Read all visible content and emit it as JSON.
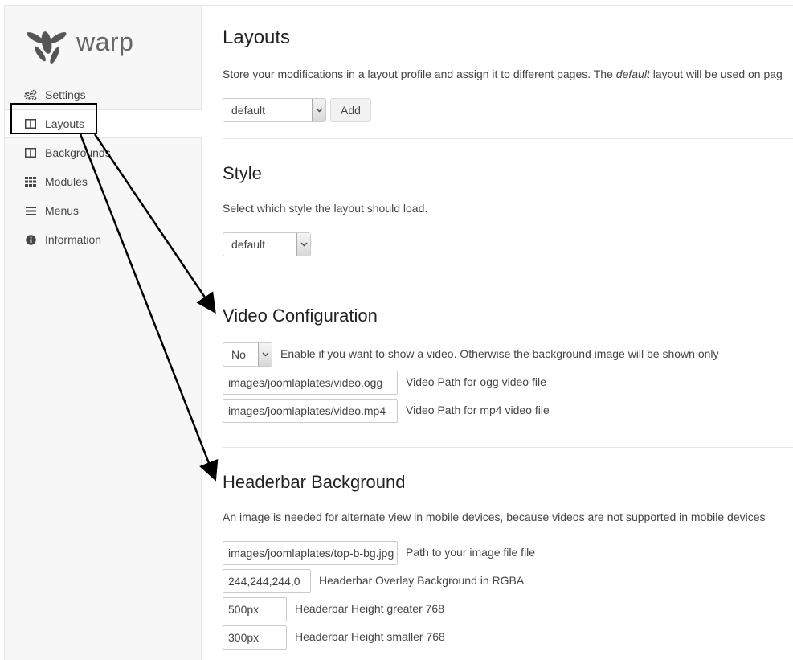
{
  "app": {
    "logo_text": "warp"
  },
  "sidebar": {
    "items": [
      {
        "label": "Settings",
        "icon": "gears-icon"
      },
      {
        "label": "Layouts",
        "icon": "columns-icon",
        "active": true
      },
      {
        "label": "Backgrounds",
        "icon": "columns-icon"
      },
      {
        "label": "Modules",
        "icon": "grid-icon"
      },
      {
        "label": "Menus",
        "icon": "bars-icon"
      },
      {
        "label": "Information",
        "icon": "info-circle-icon"
      }
    ]
  },
  "layouts": {
    "title": "Layouts",
    "desc_before": "Store your modifications in a layout profile and assign it to different pages. The ",
    "desc_em": "default",
    "desc_after": " layout will be used on pag",
    "select_value": "default",
    "add_label": "Add"
  },
  "style": {
    "title": "Style",
    "desc": "Select which style the layout should load.",
    "select_value": "default"
  },
  "video": {
    "title": "Video Configuration",
    "enable_value": "No",
    "enable_desc": "Enable if you want to show a video. Otherwise the background image will be shown only",
    "ogg_value": "images/joomlaplates/video.ogg",
    "ogg_label": "Video Path for ogg video file",
    "mp4_value": "images/joomlaplates/video.mp4",
    "mp4_label": "Video Path for mp4 video file"
  },
  "headerbar": {
    "title": "Headerbar Background",
    "desc": "An image is needed for alternate view in mobile devices, because videos are not supported in mobile devices",
    "image_value": "images/joomlaplates/top-b-bg.jpg",
    "image_label": "Path to your image file file",
    "rgba_value": "244,244,244,0",
    "rgba_label": "Headerbar Overlay Background in RGBA",
    "height_gt_value": "500px",
    "height_gt_label": "Headerbar Height greater 768",
    "height_lt_value": "300px",
    "height_lt_label": "Headerbar Height smaller 768"
  }
}
